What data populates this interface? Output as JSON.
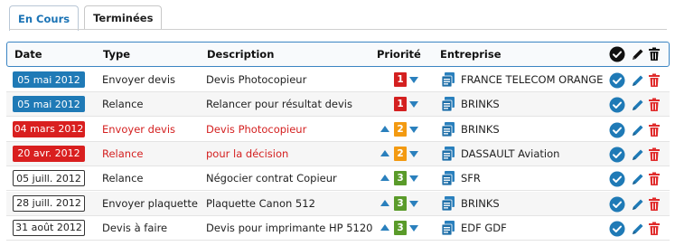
{
  "tabs": [
    {
      "label": "En Cours",
      "active": true
    },
    {
      "label": "Terminées",
      "active": false
    }
  ],
  "table": {
    "columns": {
      "date": "Date",
      "type": "Type",
      "description": "Description",
      "priority": "Priorité",
      "company": "Entreprise"
    },
    "header_icons": [
      "check-circle-icon",
      "pencil-icon",
      "trash-icon"
    ],
    "rows": [
      {
        "date": "05 mai 2012",
        "date_style": "blue",
        "type": "Envoyer devis",
        "description": "Devis Photocopieur",
        "priority": 1,
        "priority_color": "#d42020",
        "can_raise": false,
        "can_lower": true,
        "company": "FRANCE TELECOM ORANGE",
        "overdue": false
      },
      {
        "date": "05 mai 2012",
        "date_style": "blue",
        "type": "Relance",
        "description": "Relancer pour résultat devis",
        "priority": 1,
        "priority_color": "#d42020",
        "can_raise": false,
        "can_lower": true,
        "company": "BRINKS",
        "overdue": false
      },
      {
        "date": "04 mars 2012",
        "date_style": "red",
        "type": "Envoyer devis",
        "description": "Devis Photocopieur",
        "priority": 2,
        "priority_color": "#f39a11",
        "can_raise": true,
        "can_lower": true,
        "company": "BRINKS",
        "overdue": true
      },
      {
        "date": "20 avr. 2012",
        "date_style": "red",
        "type": "Relance",
        "description": "pour la décision",
        "priority": 2,
        "priority_color": "#f39a11",
        "can_raise": true,
        "can_lower": true,
        "company": "DASSAULT Aviation",
        "overdue": true
      },
      {
        "date": "05 juill. 2012",
        "date_style": "plain",
        "type": "Relance",
        "description": "Négocier contrat Copieur",
        "priority": 3,
        "priority_color": "#5a9b2a",
        "can_raise": true,
        "can_lower": true,
        "company": "SFR",
        "overdue": false
      },
      {
        "date": "28 juill. 2012",
        "date_style": "plain",
        "type": "Envoyer plaquette",
        "description": "Plaquette Canon 512",
        "priority": 3,
        "priority_color": "#5a9b2a",
        "can_raise": true,
        "can_lower": true,
        "company": "BRINKS",
        "overdue": false
      },
      {
        "date": "31 août 2012",
        "date_style": "plain",
        "type": "Devis à faire",
        "description": "Devis pour imprimante HP 5120",
        "priority": 3,
        "priority_color": "#5a9b2a",
        "can_raise": true,
        "can_lower": true,
        "company": "EDF GDF",
        "overdue": false
      }
    ]
  },
  "colors": {
    "accent_blue": "#1f7ab6",
    "alert_red": "#d42020",
    "delete_red": "#e02b2b",
    "header_border": "#3b85c3"
  }
}
